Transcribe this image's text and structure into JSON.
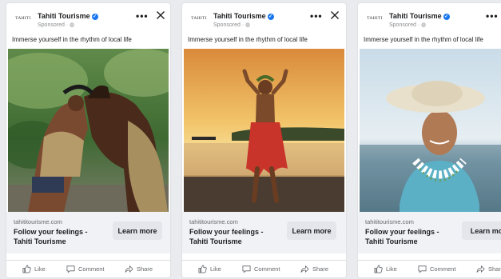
{
  "ads": [
    {
      "brand_logo": "TAHITI",
      "page_name": "Tahiti Tourisme",
      "sponsored": "Sponsored · ",
      "post_text": "Immerse yourself in the rhythm of local life",
      "domain": "tahititourisme.com",
      "headline_line1": "Follow your feelings -",
      "headline_line2": "Tahiti Tourisme",
      "cta": "Learn more",
      "image_icon": "man-with-horse-photo"
    },
    {
      "brand_logo": "TAHITI",
      "page_name": "Tahiti Tourisme",
      "sponsored": "Sponsored · ",
      "post_text": "Immerse yourself in the rhythm of local life",
      "domain": "tahititourisme.com",
      "headline_line1": "Follow your feelings -",
      "headline_line2": "Tahiti Tourisme",
      "cta": "Learn more",
      "image_icon": "dancer-on-beach-photo"
    },
    {
      "brand_logo": "TAHITI",
      "page_name": "Tahiti Tourisme",
      "sponsored": "Sponsored · ",
      "post_text": "Immerse yourself in the rhythm of local life",
      "domain": "tahititourisme.com",
      "headline_line1": "Follow your feelings -",
      "headline_line2": "Tahiti Tourisme",
      "cta": "Learn mo",
      "image_icon": "woman-with-hat-photo"
    }
  ],
  "actions": {
    "like": "Like",
    "comment": "Comment",
    "share": "Share"
  },
  "colors": {
    "verified": "#1877f2",
    "text": "#1c1e21",
    "muted": "#65676b",
    "cta_bg": "#e4e6eb"
  }
}
